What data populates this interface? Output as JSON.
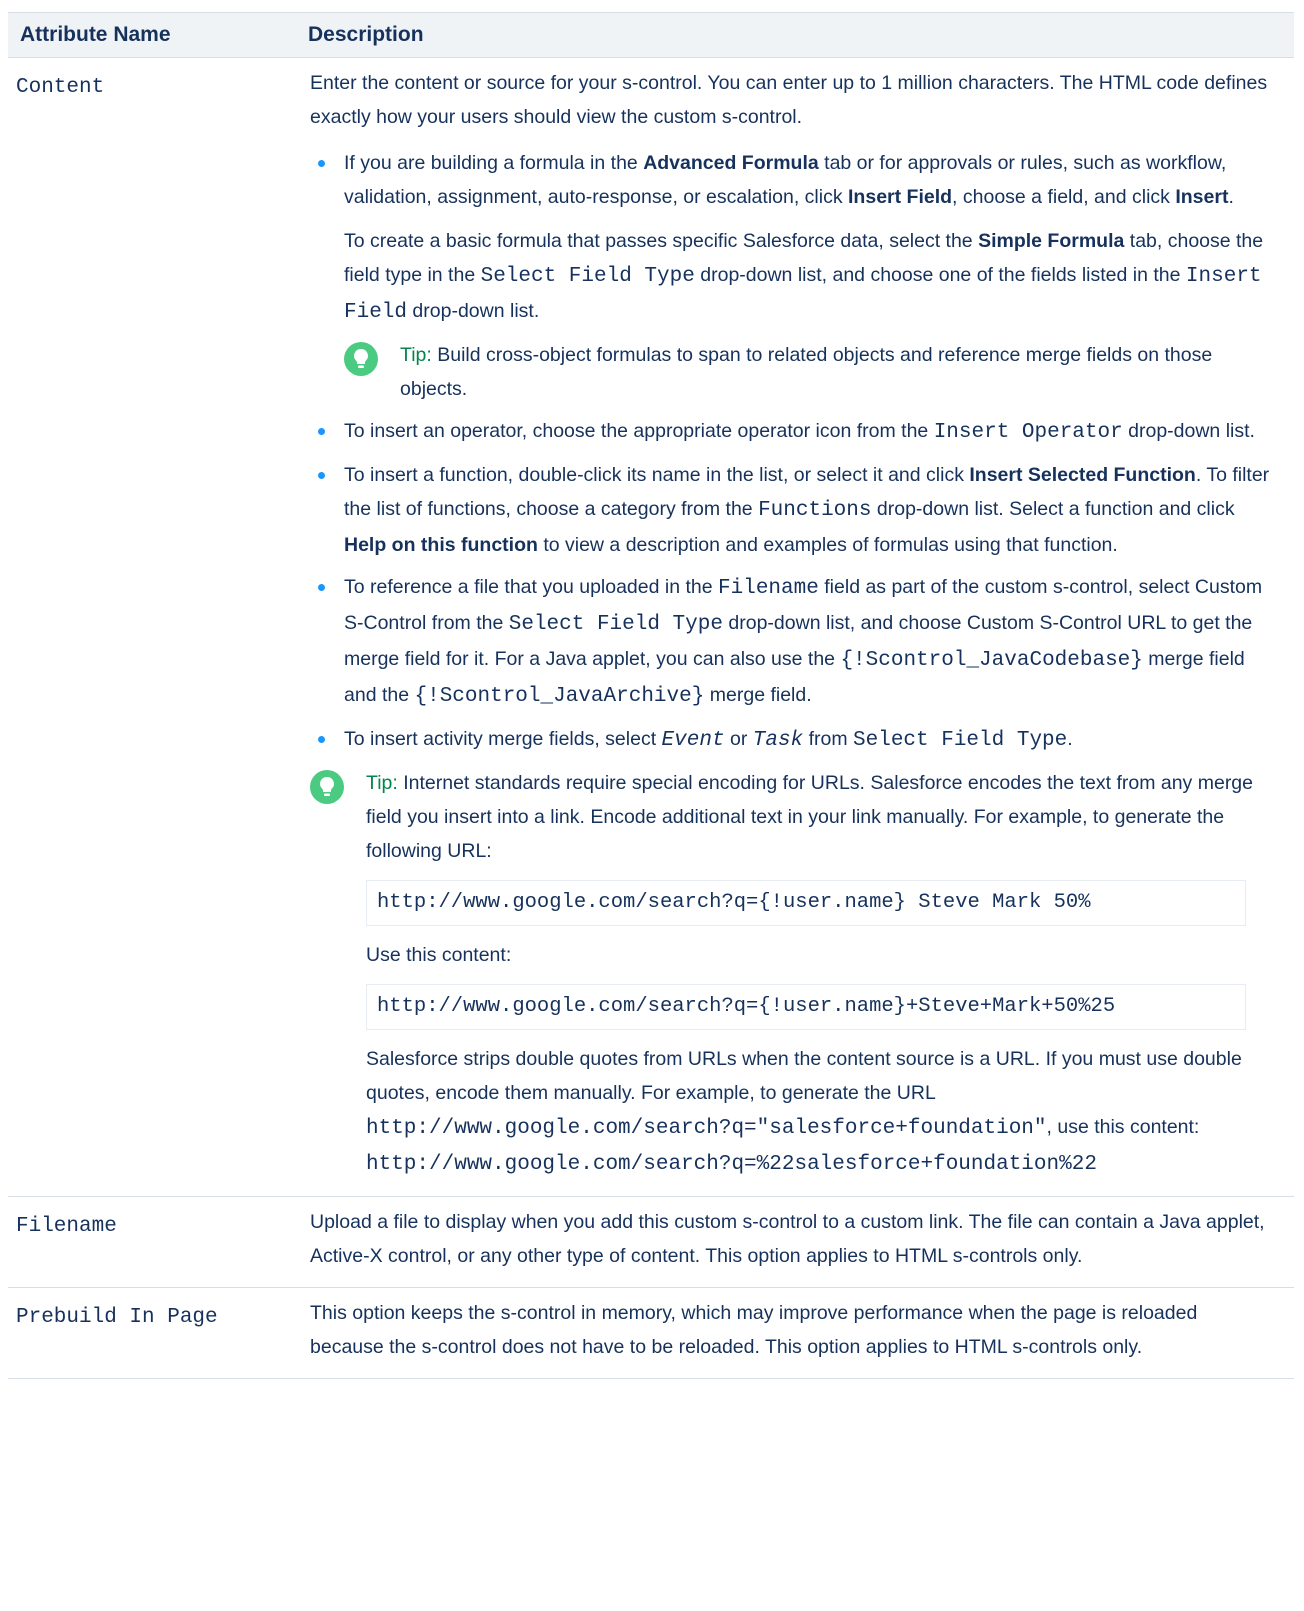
{
  "header": {
    "col1": "Attribute Name",
    "col2": "Description"
  },
  "content_row": {
    "name": "Content",
    "intro": "Enter the content or source for your s-control. You can enter up to 1 million characters. The HTML code defines exactly how your users should view the custom s-control.",
    "b1": {
      "t1": "If you are building a formula in the ",
      "bold1": "Advanced Formula",
      "t2": " tab or for approvals or rules, such as workflow, validation, assignment, auto-response, or escalation, click ",
      "bold2": "Insert Field",
      "t3": ", choose a field, and click ",
      "bold3": "Insert",
      "t4": ".",
      "p2_t1": "To create a basic formula that passes specific Salesforce data, select the ",
      "p2_bold": "Simple Formula",
      "p2_t2": " tab, choose the field type in the ",
      "p2_code1": "Select Field Type",
      "p2_t3": " drop-down list, and choose one of the fields listed in the ",
      "p2_code2": "Insert Field",
      "p2_t4": " drop-down list.",
      "tip_label": "Tip:",
      "tip_text": " Build cross-object formulas to span to related objects and reference merge fields on those objects."
    },
    "b2": {
      "t1": "To insert an operator, choose the appropriate operator icon from the ",
      "code": "Insert Operator",
      "t2": " drop-down list."
    },
    "b3": {
      "t1": "To insert a function, double-click its name in the list, or select it and click ",
      "bold1": "Insert Selected Function",
      "t2": ". To filter the list of functions, choose a category from the ",
      "code": "Functions",
      "t3": " drop-down list. Select a function and click ",
      "bold2": "Help on this function",
      "t4": " to view a description and examples of formulas using that function."
    },
    "b4": {
      "t1": "To reference a file that you uploaded in the ",
      "code1": "Filename",
      "t2": " field as part of the custom s-control, select Custom S-Control from the ",
      "code2": "Select Field Type",
      "t3": " drop-down list, and choose Custom S-Control URL to get the merge field for it. For a Java applet, you can also use the ",
      "code3": "{!Scontrol_JavaCodebase}",
      "t4": " merge field and the ",
      "code4": "{!Scontrol_JavaArchive}",
      "t5": " merge field."
    },
    "b5": {
      "t1": "To insert activity merge fields, select ",
      "it1": "Event",
      "t2": " or ",
      "it2": "Task",
      "t3": " from ",
      "code": "Select Field Type",
      "t4": "."
    },
    "tip2": {
      "label": "Tip:",
      "text": " Internet standards require special encoding for URLs. Salesforce encodes the text from any merge field you insert into a link. Encode additional text in your link manually. For example, to generate the following URL:",
      "code1": "http://www.google.com/search?q={!user.name} Steve Mark 50%",
      "use": "Use this content:",
      "code2": "http://www.google.com/search?q={!user.name}+Steve+Mark+50%25",
      "p3_t1": "Salesforce strips double quotes from URLs when the content source is a URL. If you must use double quotes, encode them manually. For example, to generate the URL ",
      "p3_code1": "http://www.google.com/search?q=\"salesforce+foundation\"",
      "p3_t2": ", use this content: ",
      "p3_code2": "http://www.google.com/search?q=%22salesforce+foundation%22"
    }
  },
  "filename_row": {
    "name": "Filename",
    "desc": "Upload a file to display when you add this custom s-control to a custom link. The file can contain a Java applet, Active-X control, or any other type of content. This option applies to HTML s-controls only."
  },
  "prebuild_row": {
    "name": "Prebuild In Page",
    "desc": "This option keeps the s-control in memory, which may improve performance when the page is reloaded because the s-control does not have to be reloaded. This option applies to HTML s-controls only."
  }
}
